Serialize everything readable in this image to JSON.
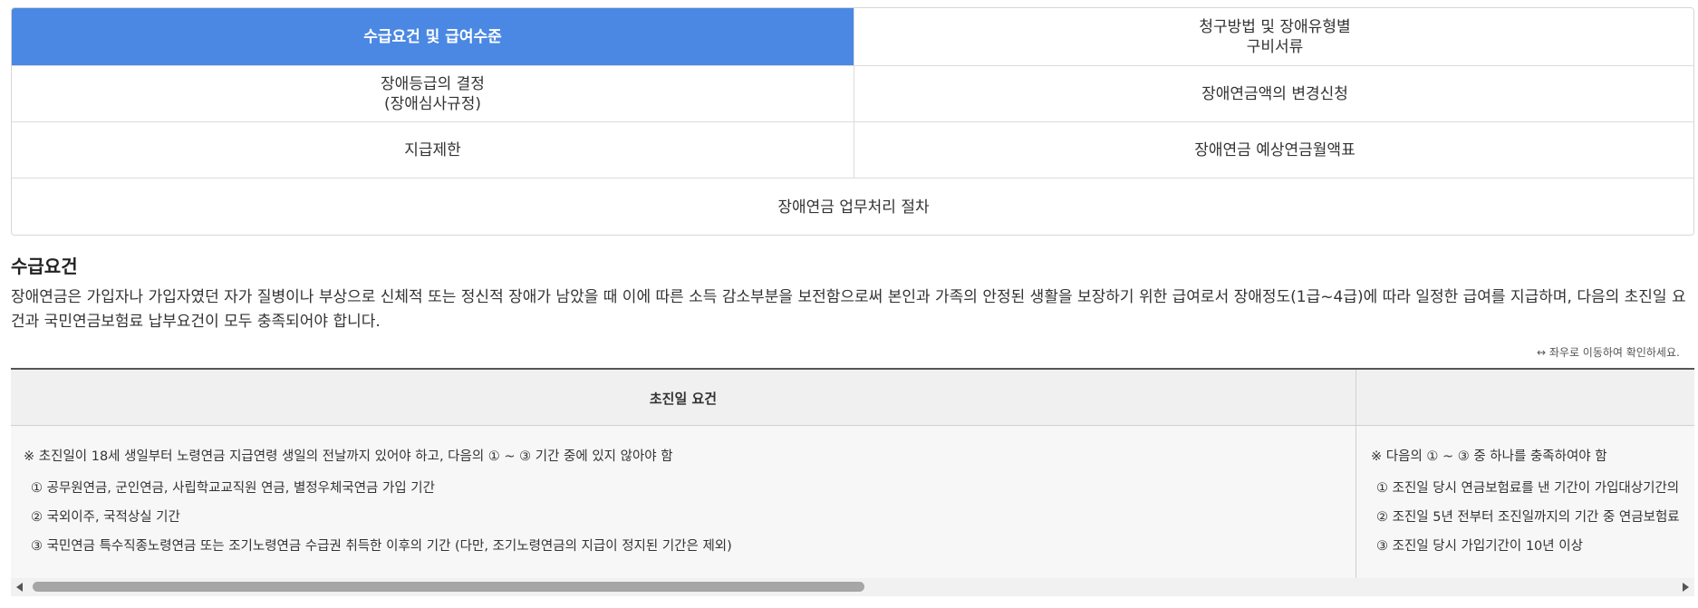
{
  "tabs": [
    {
      "label": "수급요건 및 급여수준",
      "active": true
    },
    {
      "label": "청구방법 및 장애유형별\n구비서류",
      "active": false
    },
    {
      "label": "장애등급의 결정\n(장애심사규정)",
      "active": false
    },
    {
      "label": "장애연금액의 변경신청",
      "active": false
    },
    {
      "label": "지급제한",
      "active": false
    },
    {
      "label": "장애연금 예상연금월액표",
      "active": false
    },
    {
      "label": "장애연금 업무처리 절차",
      "active": false
    }
  ],
  "section": {
    "title": "수급요건",
    "intro": "장애연금은 가입자나 가입자였던 자가 질병이나 부상으로 신체적 또는 정신적 장애가 남았을 때 이에 따른 소득 감소부분을 보전함으로써 본인과 가족의 안정된 생활을 보장하기 위한 급여로서 장애정도(1급~4급)에 따라 일정한 급여를 지급하며, 다음의 초진일 요건과 국민연금보험료 납부요건이 모두 충족되어야 합니다."
  },
  "scroll_hint": "↔ 좌우로 이동하여 확인하세요.",
  "table": {
    "headers": [
      "초진일 요건",
      ""
    ],
    "col1": {
      "note": "※ 초진일이 18세 생일부터 노령연금 지급연령 생일의 전날까지 있어야 하고, 다음의 ① ~ ③ 기간 중에 있지 않아야 함",
      "items": [
        "① 공무원연금, 군인연금, 사립학교교직원 연금, 별정우체국연금 가입 기간",
        "② 국외이주, 국적상실 기간",
        "③ 국민연금 특수직종노령연금 또는 조기노령연금 수급권 취득한 이후의 기간 (다만, 조기노령연금의 지급이 정지된 기간은 제외)"
      ]
    },
    "col2": {
      "note": "※ 다음의 ① ~ ③ 중 하나를 충족하여야 함",
      "items": [
        "① 조진일 당시 연금보험료를 낸 기간이 가입대상기간의",
        "② 조진일 5년 전부터 조진일까지의 기간 중 연금보험료",
        "③ 조진일 당시 가입기간이 10년 이상"
      ]
    }
  },
  "scrollbar": {
    "position": 0.0
  }
}
